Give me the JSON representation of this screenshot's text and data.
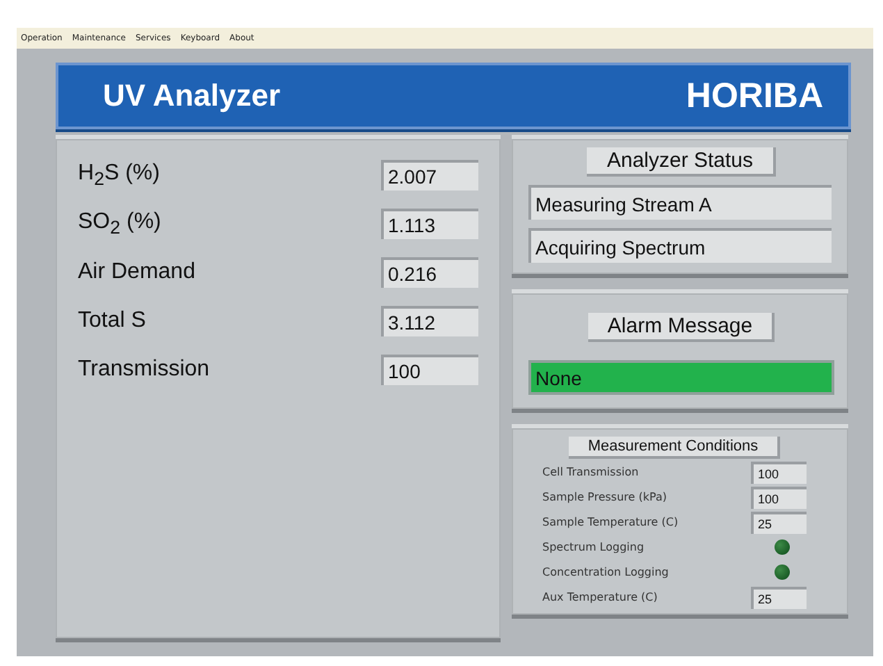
{
  "menu": [
    "Operation",
    "Maintenance",
    "Services",
    "Keyboard",
    "About"
  ],
  "header": {
    "title": "UV Analyzer",
    "brand": "HORIBA"
  },
  "readings": [
    {
      "label": "H$_{2}$S (%)",
      "value": "2.007"
    },
    {
      "label": "SO$_{2}$ (%)",
      "value": "1.113"
    },
    {
      "label": "Air Demand",
      "value": "0.216"
    },
    {
      "label": "Total S",
      "value": "3.112"
    },
    {
      "label": "Transmission",
      "value": "100"
    }
  ],
  "status": {
    "title": "Analyzer Status",
    "lines": [
      "Measuring Stream A",
      "Acquiring Spectrum"
    ]
  },
  "alarm": {
    "title": "Alarm Message",
    "message": "None",
    "active": false
  },
  "conditions": {
    "title": "Measurement Conditions",
    "items": [
      {
        "kind": "field",
        "label": "Cell Transmission",
        "value": "100"
      },
      {
        "kind": "field",
        "label": "Sample Pressure (kPa)",
        "value": "100"
      },
      {
        "kind": "field",
        "label": "Sample Temperature (C)",
        "value": "25"
      },
      {
        "kind": "led",
        "label": "Spectrum Logging",
        "on": false
      },
      {
        "kind": "led",
        "label": "Concentration Logging",
        "on": false
      },
      {
        "kind": "field",
        "label": "Aux Temperature (C)",
        "value": "25"
      }
    ]
  }
}
